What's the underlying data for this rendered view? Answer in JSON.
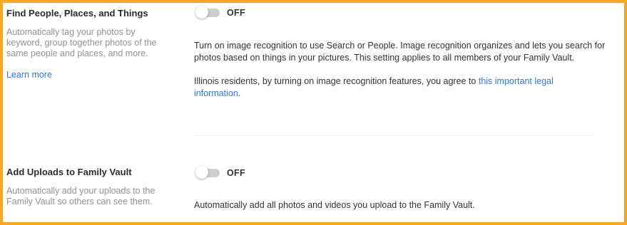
{
  "image_recognition": {
    "title": "Find People, Places, and Things",
    "description": "Automatically tag your photos by keyword, group together photos of the same people and places, and more.",
    "learn_more": "Learn more",
    "toggle_state": "OFF",
    "body": "Turn on image recognition to use Search or People. Image recognition organizes and lets you search for photos based on things in your pictures. This setting applies to all members of your Family Vault.",
    "legal_prefix": "Illinois residents, by turning on image recognition features, you agree to ",
    "legal_link": "this important legal information",
    "legal_suffix": "."
  },
  "add_uploads": {
    "title": "Add Uploads to Family Vault",
    "description": "Automatically add your uploads to the Family Vault so others can see them.",
    "toggle_state": "OFF",
    "body": "Automatically add all photos and videos you upload to the Family Vault."
  },
  "colors": {
    "frame_border": "#f5a623",
    "link": "#2f7ad6",
    "muted_text": "#8a93a0"
  }
}
